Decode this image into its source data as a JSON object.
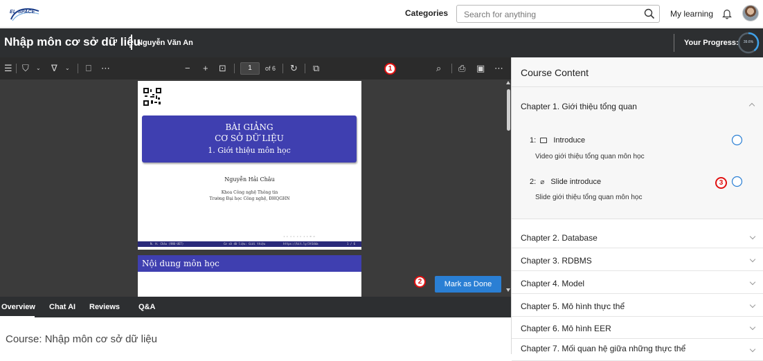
{
  "topnav": {
    "logo_text": "EL-SPACE",
    "categories_label": "Categories",
    "search_placeholder": "Search for anything",
    "my_learning_label": "My learning"
  },
  "course": {
    "title": "Nhập môn cơ sở dữ liệu",
    "author": "Nguyễn Văn An",
    "progress_label": "Your Progress:",
    "progress_value": "39.6%",
    "progress_fraction": 0.396
  },
  "viewer": {
    "page_current": "1",
    "page_total_label": "of 6",
    "slide": {
      "line1": "BÀI GIẢNG",
      "line2": "CƠ SỞ DỮ LIỆU",
      "line3": "1. Giới thiệu môn học",
      "author": "Nguyễn Hải Châu",
      "affiliation1": "Khoa Công nghệ Thông tin",
      "affiliation2": "Trường Đại học Công nghệ, ĐHQGHN",
      "footer_left": "N. H. Châu (VNU-UET)",
      "footer_mid": "Cơ sở dữ liệu: Giới thiệu",
      "footer_right": "https://bit.ly/3tS4da",
      "footer_page": "1 / 6"
    },
    "next_slide_title": "Nội dung môn học",
    "mark_done_label": "Mark as Done"
  },
  "badges": {
    "b1": "1",
    "b2": "2",
    "b3": "3"
  },
  "tabs": [
    "Overview",
    "Chat AI",
    "Reviews",
    "Q&A"
  ],
  "overview_text": "Course: Nhập môn cơ sở dữ liệu",
  "sidebar": {
    "title": "Course Content",
    "chapter1": {
      "title": "Chapter 1. Giới thiệu tổng quan",
      "lessons": [
        {
          "index": "1:",
          "title": "Introduce",
          "desc": "Video giới thiệu tổng quan môn học",
          "icon": "video-icon"
        },
        {
          "index": "2:",
          "title": "Slide introduce",
          "desc": "Slide giới thiệu tổng quan môn học",
          "icon": "attachment-icon"
        }
      ]
    },
    "chapters": [
      "Chapter 2. Database",
      "Chapter 3. RDBMS",
      "Chapter 4. Model",
      "Chapter 5. Mô hình thực thể",
      "Chapter 6. Mô hình EER",
      "Chapter 7. Mối quan hệ giữa những thực thể"
    ]
  },
  "colors": {
    "accent": "#2a7fd4",
    "header_bg": "#2d2f31",
    "slide_blue": "#3f3fb0",
    "badge_red": "#e01010"
  }
}
